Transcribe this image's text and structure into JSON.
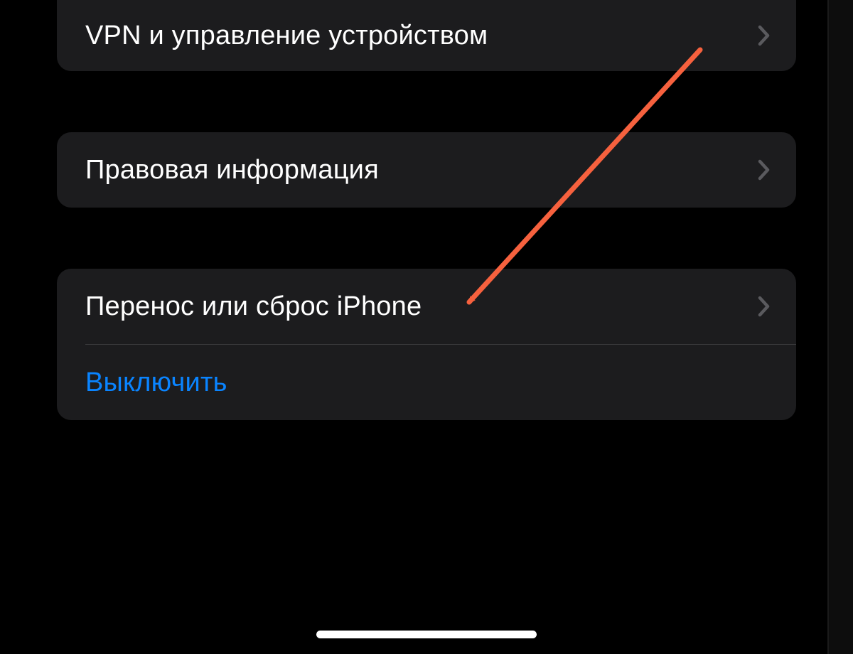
{
  "groups": {
    "g1": {
      "vpn": {
        "label": "VPN и управление устройством"
      }
    },
    "g2": {
      "legal": {
        "label": "Правовая информация"
      }
    },
    "g3": {
      "transfer": {
        "label": "Перенос или сброс iPhone"
      },
      "shutdown": {
        "label": "Выключить"
      }
    }
  },
  "colors": {
    "cell_bg": "#1c1c1e",
    "text": "#ffffff",
    "accent": "#0a84ff",
    "chevron": "#5a5a5e",
    "annotation_arrow": "#f6613e"
  }
}
